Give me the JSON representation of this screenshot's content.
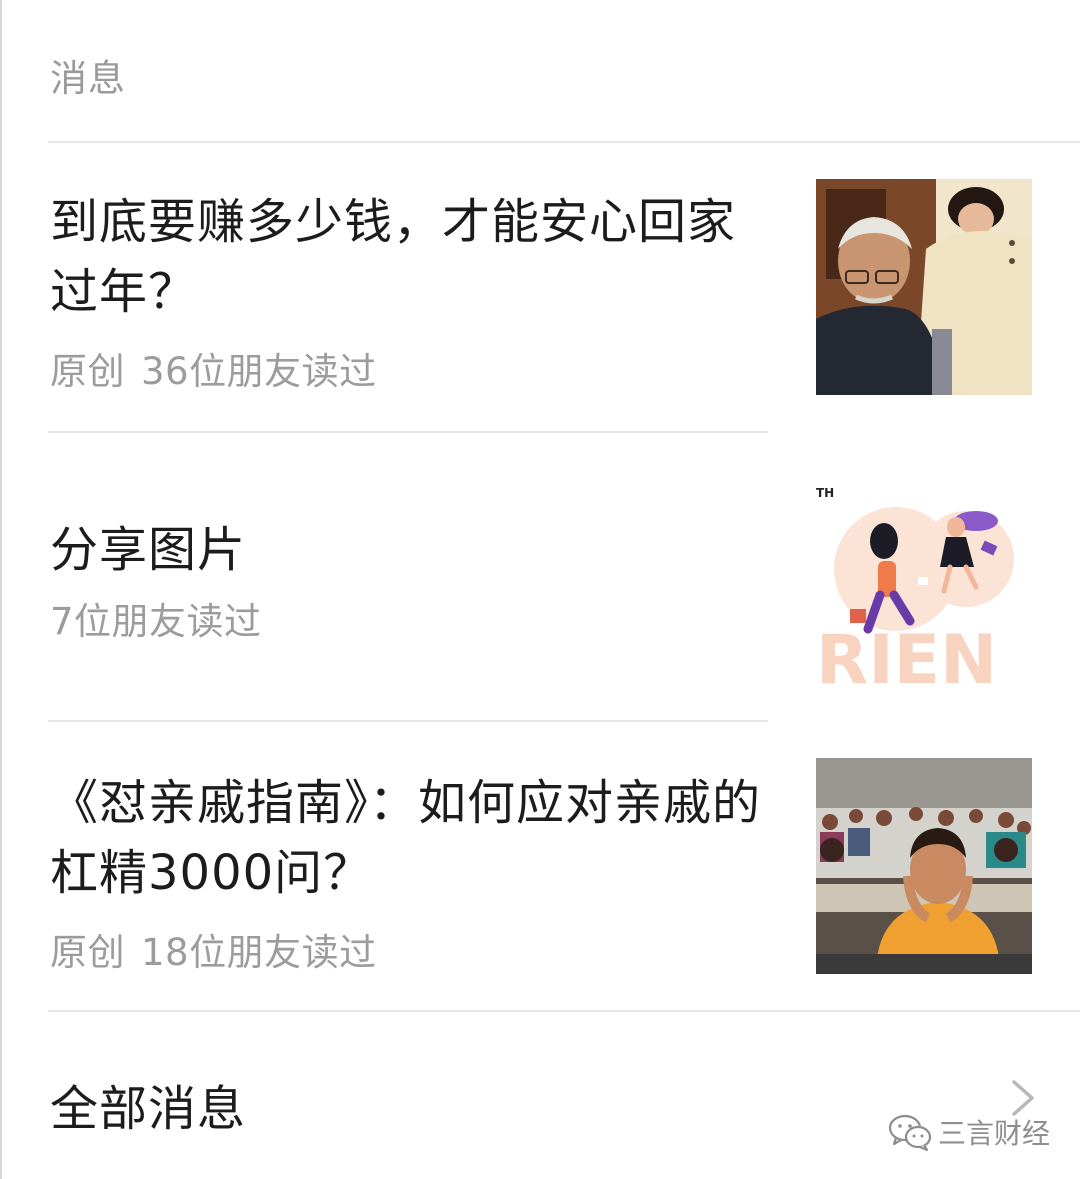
{
  "section": {
    "title": "消息"
  },
  "articles": [
    {
      "title": "到底要赚多少钱，才能安心回家过年？",
      "tag": "原创",
      "reads": "36位朋友读过",
      "thumbnail": "photo-elderly-man-and-woman"
    },
    {
      "title": "分享图片",
      "tag": "",
      "reads": "7位朋友读过",
      "thumbnail": "illustration-jumping-friends",
      "thumbnail_text": "RIEN",
      "thumbnail_corner_text": "TH"
    },
    {
      "title": "《怼亲戚指南》：如何应对亲戚的杠精3000问？",
      "tag": "原创",
      "reads": "18位朋友读过",
      "thumbnail": "photo-classroom-student"
    }
  ],
  "footer": {
    "all_messages_label": "全部消息",
    "chevron_icon": "chevron-right-icon"
  },
  "watermark": {
    "text": "三言财经",
    "icon": "wechat-icon"
  },
  "colors": {
    "primary_text": "#1c1c1c",
    "secondary_text": "#9c9c9c",
    "divider": "#e6e6e6"
  }
}
